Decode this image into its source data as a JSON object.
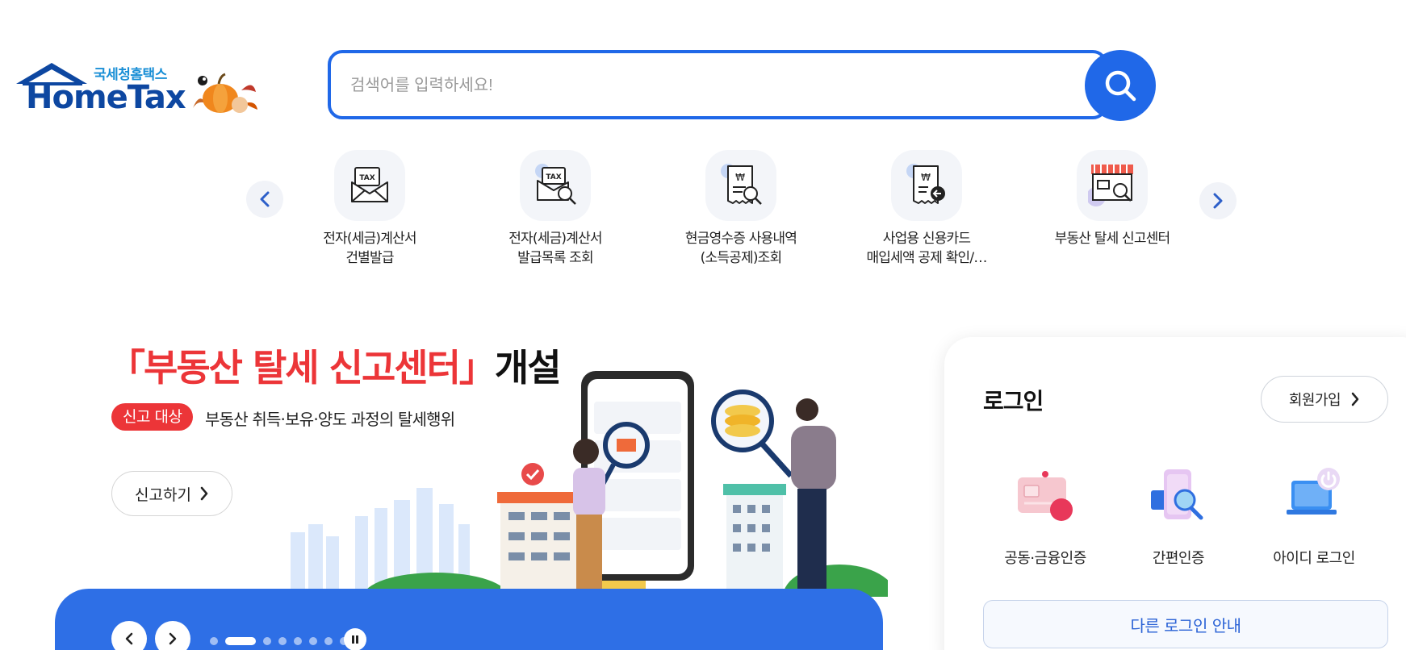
{
  "header": {
    "logo_sub": "국세청홈택스",
    "logo_main": "HomeTax"
  },
  "search": {
    "placeholder": "검색어를 입력하세요!"
  },
  "quick_menu": {
    "items": [
      {
        "line1": "전자(세금)계산서",
        "line2": "건별발급",
        "icon": "tax-envelope-icon"
      },
      {
        "line1": "전자(세금)계산서",
        "line2": "발급목록 조회",
        "icon": "tax-envelope-search-icon"
      },
      {
        "line1": "현금영수증 사용내역",
        "line2": "(소득공제)조회",
        "icon": "receipt-search-icon"
      },
      {
        "line1": "사업용 신용카드",
        "line2": "매입세액 공제 확인/…",
        "icon": "receipt-card-icon"
      },
      {
        "line1": "부동산 탈세 신고센터",
        "line2": "",
        "icon": "store-search-icon"
      }
    ]
  },
  "banner": {
    "title_red": "「부동산 탈세 신고센터」",
    "title_black": "개설",
    "badge": "신고 대상",
    "description": "부동산 취득·보유·양도 과정의 탈세행위",
    "button": "신고하기",
    "slide_count": 8,
    "active_slide": 1
  },
  "login": {
    "title": "로그인",
    "join_button": "회원가입",
    "options": [
      {
        "label": "공동·금융인증",
        "icon": "certificate-card-icon"
      },
      {
        "label": "간편인증",
        "icon": "phone-search-icon"
      },
      {
        "label": "아이디 로그인",
        "icon": "laptop-power-icon"
      }
    ],
    "other_login": "다른 로그인 안내"
  },
  "colors": {
    "primary": "#2068e8",
    "accent_red": "#ec3538",
    "logo_blue": "#0d47a1"
  }
}
